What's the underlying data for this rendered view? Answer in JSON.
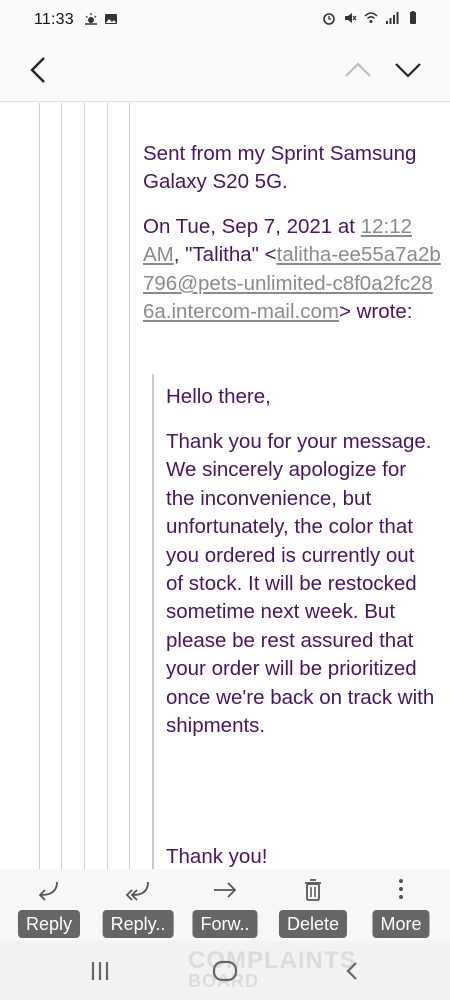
{
  "status_bar": {
    "time": "11:33",
    "left_icons": [
      "weather-icon",
      "gallery-icon"
    ],
    "right_icons": [
      "alarm-icon",
      "mute-icon",
      "wifi-icon",
      "signal-icon",
      "battery-icon"
    ]
  },
  "email": {
    "sent_from": "Sent from my Sprint Samsung Galaxy S20 5G.",
    "on_prefix": "On Tue, Sep 7, 2021 at",
    "time_link": "12:12 AM",
    "sender_name_part": ", \"Talitha\" <",
    "email_link": "talitha-ee55a7a2b796@pets-unlimited-c8f0a2fc286a.intercom-mail.com",
    "wrote_suffix": "> wrote:",
    "greeting": "Hello there,",
    "body": "Thank you for your message. We sincerely apologize for the inconvenience, but unfortunately, the color that you ordered is currently out of stock. It will be restocked sometime next week. But please be rest assured that your order will be prioritized once we're back on track with shipments.",
    "closing": "Thank you!"
  },
  "actions": [
    {
      "label": "Reply",
      "icon": "reply-icon"
    },
    {
      "label": "Reply..",
      "icon": "reply-all-icon"
    },
    {
      "label": "Forw..",
      "icon": "forward-icon"
    },
    {
      "label": "Delete",
      "icon": "trash-icon"
    },
    {
      "label": "More",
      "icon": "more-vertical-icon"
    }
  ],
  "watermark": {
    "line1": "COMPLAINTS",
    "line2": "BOARD"
  },
  "colors": {
    "text": "#4a1560",
    "link": "#8a8a8a",
    "label_bg": "#666666"
  }
}
